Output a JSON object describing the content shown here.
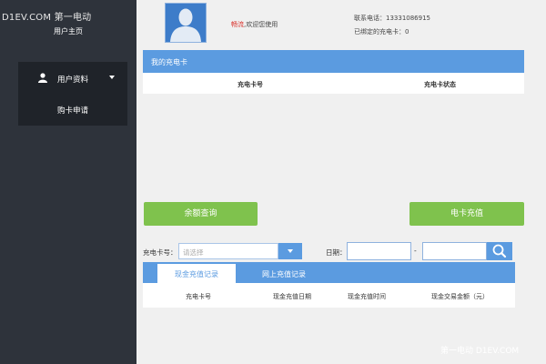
{
  "watermark": {
    "top_left": "D1EV.COM 第一电动",
    "bottom_right": "第一电动 D1EV.COM"
  },
  "sidebar": {
    "home_label": "用户主页",
    "items": [
      {
        "label": "用户资料",
        "icon": "user-icon",
        "expanded": true
      },
      {
        "label": "购卡申请"
      }
    ]
  },
  "header": {
    "user_name": "畅流",
    "greeting_suffix": ",欢迎您使用",
    "phone_line": "联系电话：13331086915",
    "bound_cards_line": "已绑定的充电卡：0"
  },
  "my_cards": {
    "title": "我的充电卡",
    "columns": [
      "充电卡号",
      "充电卡状态"
    ]
  },
  "actions": {
    "balance_query": "余额查询",
    "card_recharge": "电卡充值"
  },
  "filter": {
    "card_label": "充电卡号：",
    "card_placeholder": "请选择",
    "date_label": "日期：",
    "date_separator": "-"
  },
  "records": {
    "tabs": [
      {
        "label": "现金充值记录",
        "active": true
      },
      {
        "label": "网上充值记录",
        "active": false
      }
    ],
    "columns": [
      "充电卡号",
      "现金充值日期",
      "现金充值时间",
      "现金交易金额（元）"
    ]
  },
  "colors": {
    "sidebar_bg": "#2e333b",
    "menu_bg": "#1f2329",
    "accent_blue": "#5b9be0",
    "button_green": "#7fc24d",
    "user_name_red": "#d9302a",
    "page_bg": "#f0f0f0"
  }
}
